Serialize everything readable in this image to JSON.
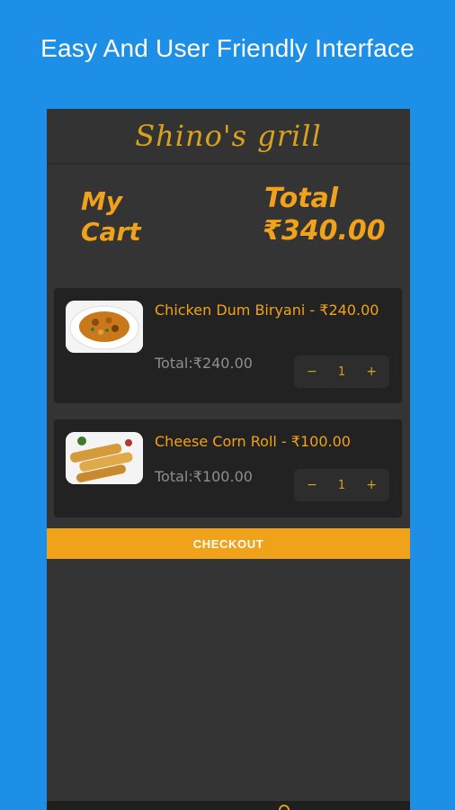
{
  "promo": {
    "heading": "Easy And User Friendly Interface"
  },
  "header": {
    "brand": "Shino's grill"
  },
  "summary": {
    "cart_title_line1": "My",
    "cart_title_line2": "Cart",
    "total_label": "Total",
    "total_amount": "₹340.00"
  },
  "items": [
    {
      "name": "Chicken Dum Biryani - ₹240.00",
      "total": "Total:₹240.00",
      "qty": "1",
      "minus": "−",
      "plus": "+",
      "image_icon": "biryani-plate-icon"
    },
    {
      "name": "Cheese Corn Roll - ₹100.00",
      "total": "Total:₹100.00",
      "qty": "1",
      "minus": "−",
      "plus": "+",
      "image_icon": "spring-rolls-icon"
    }
  ],
  "checkout": {
    "label": "CHECKOUT"
  },
  "colors": {
    "background_blue": "#1e8fe6",
    "accent_orange": "#f0a21a",
    "panel_dark": "#343434",
    "card_dark": "#222222"
  }
}
